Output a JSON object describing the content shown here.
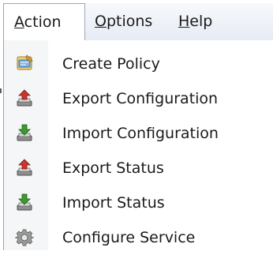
{
  "menubar": {
    "action": {
      "first": "A",
      "rest": "ction"
    },
    "options": {
      "first": "O",
      "rest": "ptions"
    },
    "help": {
      "first": "H",
      "rest": "elp"
    }
  },
  "menu": {
    "items": [
      {
        "label": "Create Policy",
        "icon": "create-policy-icon"
      },
      {
        "label": "Export Configuration",
        "icon": "export-icon"
      },
      {
        "label": "Import Configuration",
        "icon": "import-icon"
      },
      {
        "label": "Export Status",
        "icon": "export-icon"
      },
      {
        "label": "Import Status",
        "icon": "import-icon"
      },
      {
        "label": "Configure Service",
        "icon": "gear-icon"
      }
    ]
  },
  "colors": {
    "menu_bg": "#ffffff",
    "gutter_bg": "#f5f6f7",
    "menubar_top": "#f7f9fc",
    "menubar_bottom": "#e6ecf4",
    "border": "#9aa6b3",
    "text": "#1a1a1a",
    "export_arrow": "#c8372d",
    "import_arrow": "#3f9a2e"
  }
}
